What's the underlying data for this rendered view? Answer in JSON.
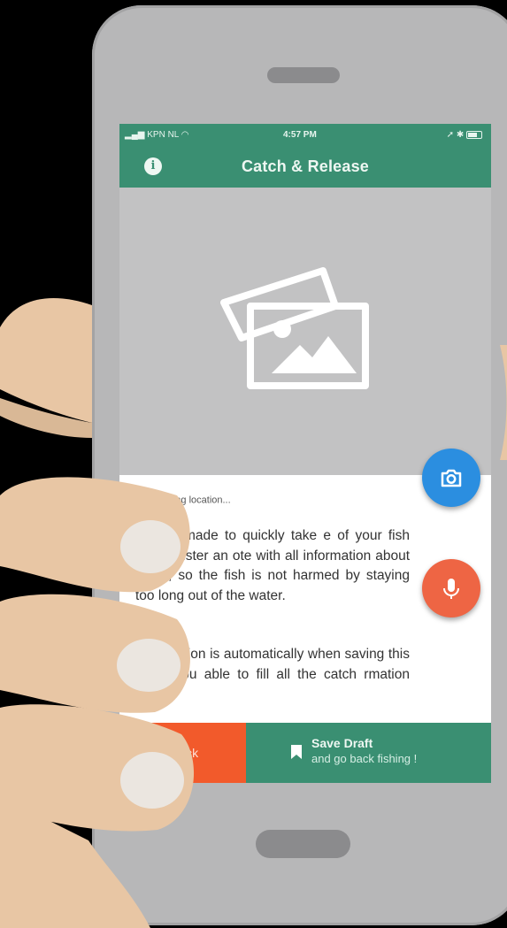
{
  "status_bar": {
    "carrier": "KPN NL",
    "time": "4:57 PM"
  },
  "app_bar": {
    "title": "Catch & Release",
    "info_icon": "info-icon"
  },
  "photo": {
    "placeholder_icon": "image-placeholder-icon"
  },
  "content": {
    "loading_text": "fetching location...",
    "paragraph_1": "atch is made to quickly take e of your fish and register an ote with all information about catch, so the fish is not harmed by staying too long out of the water.",
    "paragraph_2": "ed, location is automatically when saving this draft. You able to fill all the catch rmation later."
  },
  "fabs": {
    "camera_icon": "camera-icon",
    "mic_icon": "microphone-icon"
  },
  "footer": {
    "back_label": "Back",
    "save_title": "Save Draft",
    "save_subtitle": "and go back fishing !"
  },
  "colors": {
    "primary": "#3a8f72",
    "accent_orange": "#f25a2b",
    "camera_blue": "#2b8ee0",
    "mic_orange": "#ee6544",
    "photo_bg": "#c2c2c3"
  }
}
